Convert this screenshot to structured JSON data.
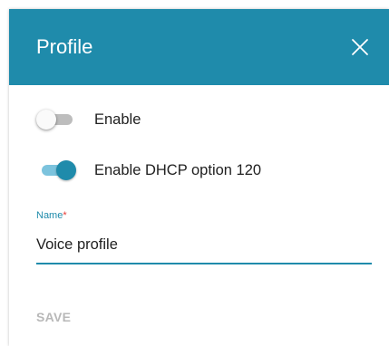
{
  "dialog": {
    "title": "Profile",
    "close_icon": "close-icon"
  },
  "toggles": [
    {
      "label": "Enable",
      "checked": false
    },
    {
      "label": "Enable DHCP option 120",
      "checked": true
    }
  ],
  "name_field": {
    "label": "Name",
    "required_marker": "*",
    "value": "Voice profile"
  },
  "actions": {
    "save_label": "SAVE",
    "save_enabled": false
  },
  "colors": {
    "accent": "#1f8bab",
    "required": "#e53935",
    "disabled_text": "#b8b8b8"
  }
}
